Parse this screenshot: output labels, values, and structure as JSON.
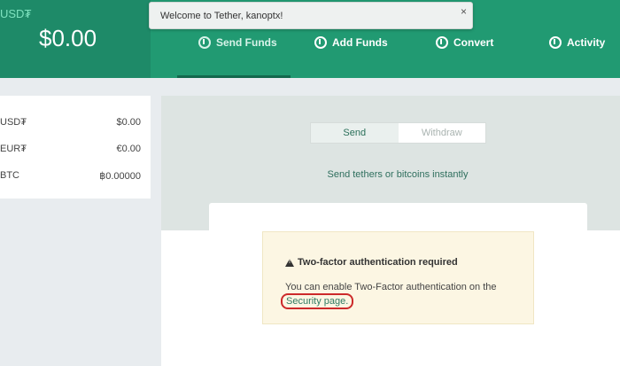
{
  "header": {
    "currency": "USD₮",
    "balance": "$0.00",
    "nav": [
      {
        "label": "Send Funds",
        "icon": "send-icon"
      },
      {
        "label": "Add Funds",
        "icon": "add-funds-icon"
      },
      {
        "label": "Convert",
        "icon": "convert-icon"
      },
      {
        "label": "Activity",
        "icon": "activity-icon"
      }
    ]
  },
  "toast": {
    "message": "Welcome to Tether, kanoptx!",
    "close": "×"
  },
  "balances": [
    {
      "currency": "USD₮",
      "amount": "$0.00"
    },
    {
      "currency": "EUR₮",
      "amount": "€0.00"
    },
    {
      "currency": "BTC",
      "amount": "฿0.00000"
    }
  ],
  "main": {
    "tabs": [
      {
        "label": "Send",
        "active": true
      },
      {
        "label": "Withdraw",
        "active": false
      }
    ],
    "subtitle": "Send tethers or bitcoins instantly"
  },
  "alert": {
    "title": "Two-factor authentication required",
    "body": "You can enable Two-Factor authentication on the",
    "link": "Security page."
  },
  "colors": {
    "header_dark": "#1e8a68",
    "header_nav": "#219a72",
    "alert_bg": "#fcf6e3",
    "highlight": "#cc2a2a"
  }
}
